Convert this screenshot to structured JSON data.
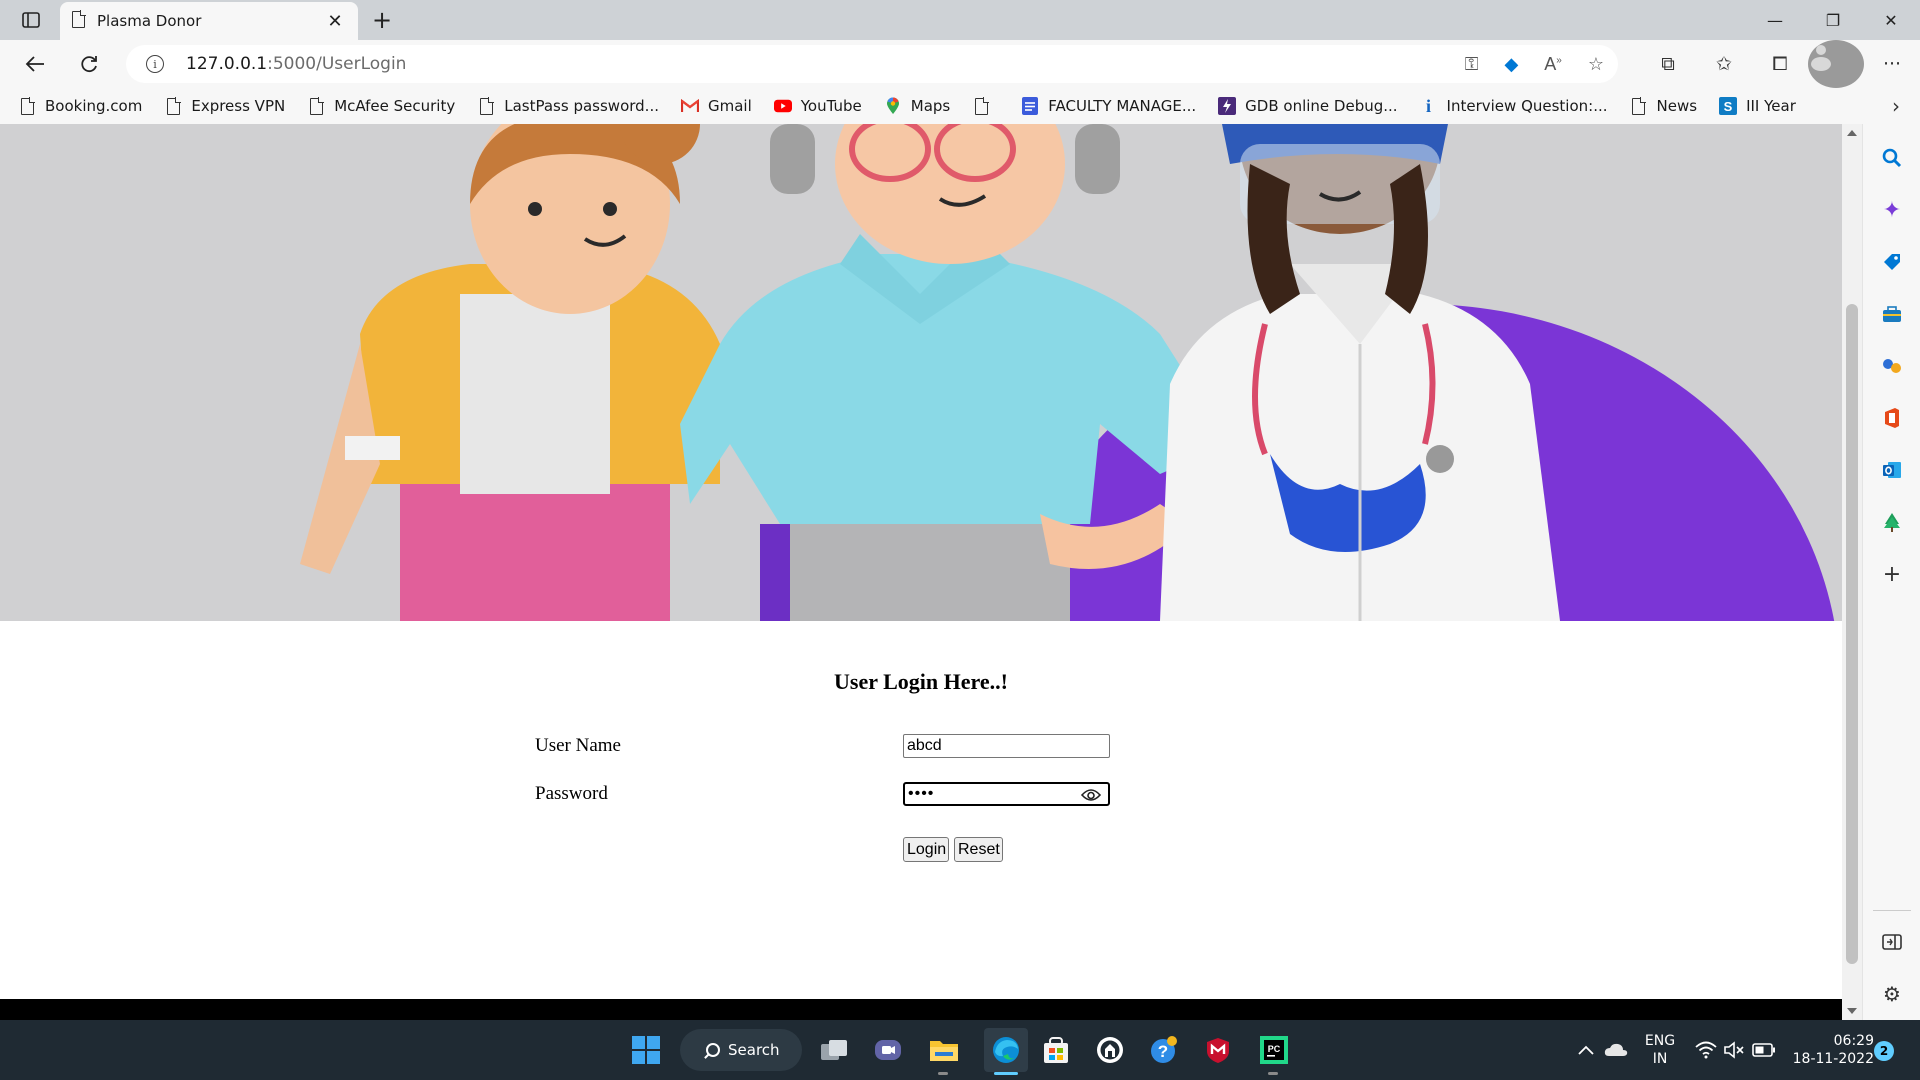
{
  "browser": {
    "tab_title": "Plasma Donor",
    "tab_close": "✕",
    "new_tab": "+",
    "url_host": "127.0.0.1",
    "url_path": ":5000/UserLogin",
    "window_controls": {
      "minimize": "—",
      "maximize": "❐",
      "close": "✕"
    }
  },
  "bookmarks": [
    {
      "label": "Booking.com",
      "icon": "document-icon"
    },
    {
      "label": "Express VPN",
      "icon": "document-icon"
    },
    {
      "label": "McAfee Security",
      "icon": "document-icon"
    },
    {
      "label": "LastPass password...",
      "icon": "document-icon"
    },
    {
      "label": "Gmail",
      "icon": "gmail-icon"
    },
    {
      "label": "YouTube",
      "icon": "youtube-icon"
    },
    {
      "label": "Maps",
      "icon": "maps-icon"
    },
    {
      "label": "",
      "icon": "document-icon"
    },
    {
      "label": "FACULTY MANAGE...",
      "icon": "forms-icon"
    },
    {
      "label": "GDB online Debug...",
      "icon": "gdb-icon"
    },
    {
      "label": "Interview Question:...",
      "icon": "info-icon"
    },
    {
      "label": "News",
      "icon": "document-icon"
    },
    {
      "label": "III Year",
      "icon": "sway-icon"
    }
  ],
  "page": {
    "heading": "User Login Here..!",
    "username_label": "User Name",
    "username_value": "abcd",
    "password_label": "Password",
    "password_value": "abcd",
    "login_button": "Login",
    "reset_button": "Reset"
  },
  "taskbar": {
    "search_label": "Search",
    "language_line1": "ENG",
    "language_line2": "IN",
    "time": "06:29",
    "date": "18-11-2022",
    "notification_count": "2"
  },
  "colors": {
    "hero_background": "#d0d0d2",
    "hero_accent_purple": "#7b35d6",
    "taskbar": "#1f2a33",
    "edge_blue": "#0078d4"
  }
}
